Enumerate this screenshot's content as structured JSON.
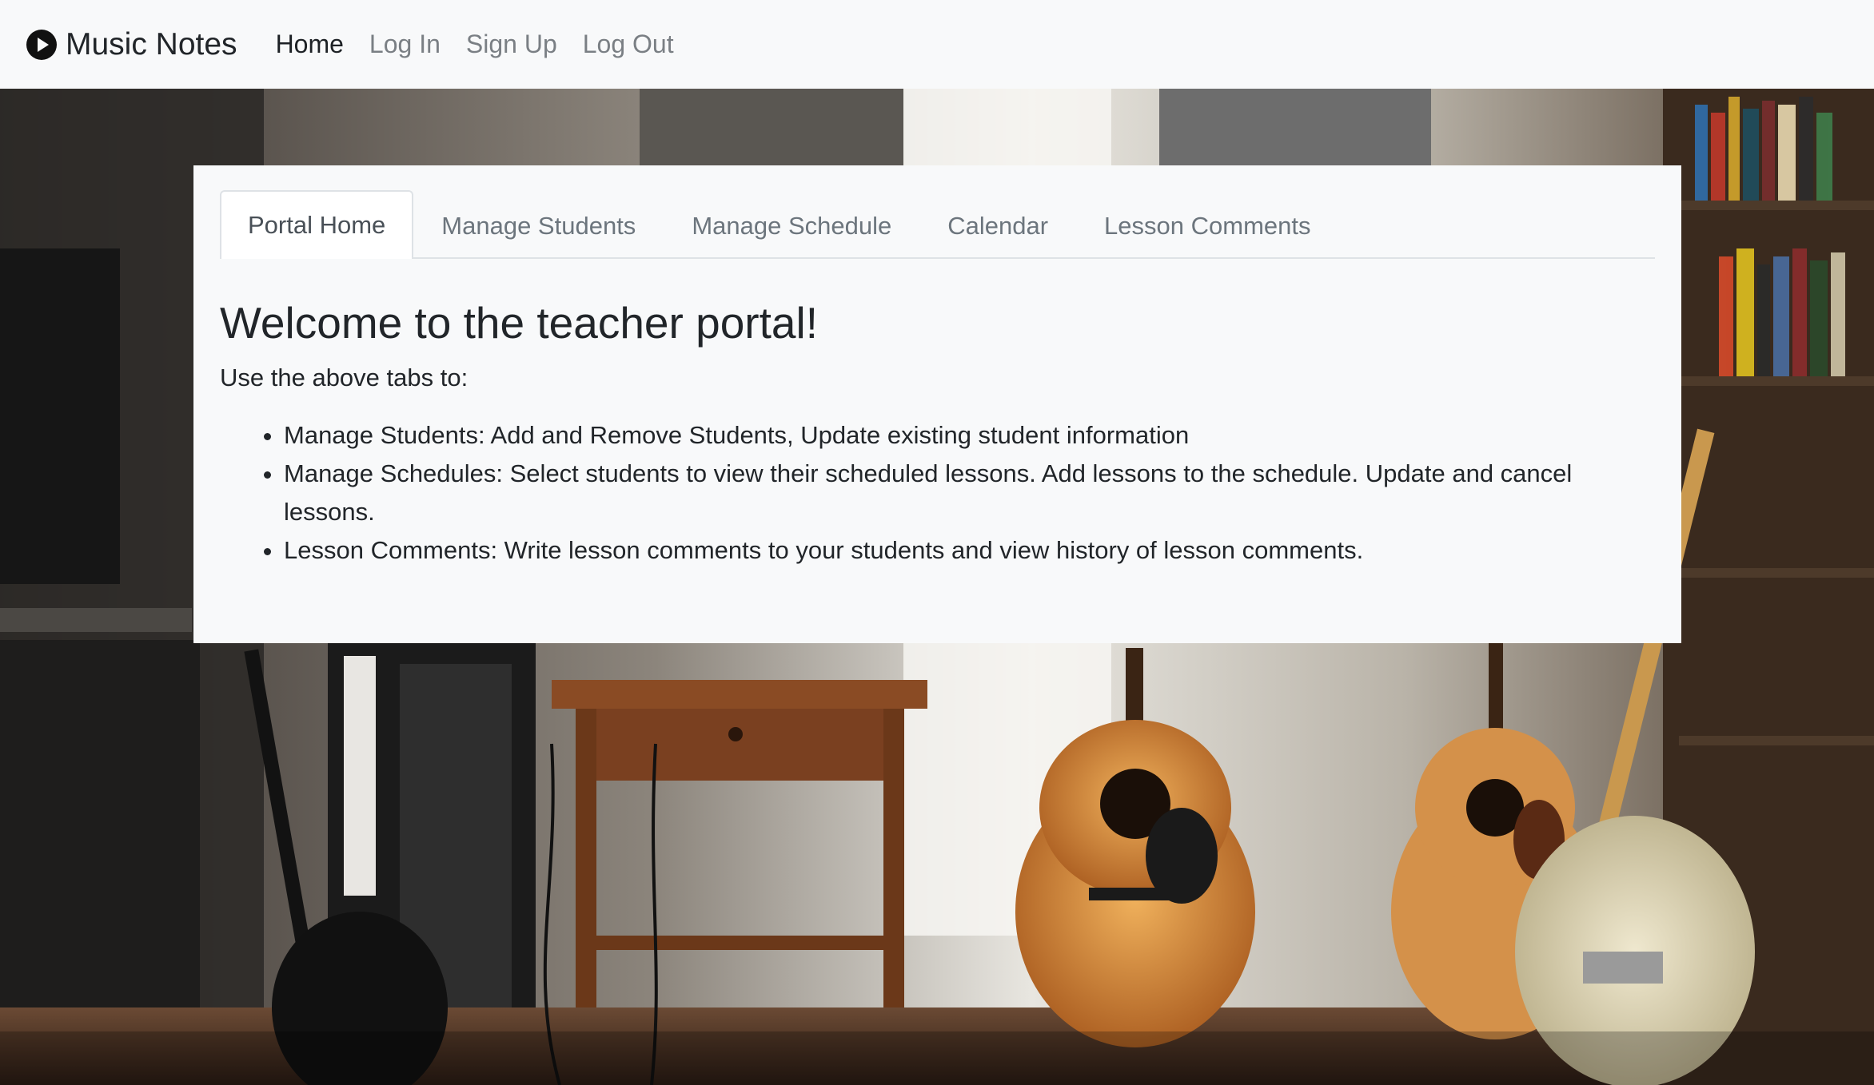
{
  "navbar": {
    "brand": "Music Notes",
    "links": [
      {
        "label": "Home",
        "active": true
      },
      {
        "label": "Log In",
        "active": false
      },
      {
        "label": "Sign Up",
        "active": false
      },
      {
        "label": "Log Out",
        "active": false
      }
    ]
  },
  "tabs": [
    {
      "label": "Portal Home",
      "active": true
    },
    {
      "label": "Manage Students",
      "active": false
    },
    {
      "label": "Manage Schedule",
      "active": false
    },
    {
      "label": "Calendar",
      "active": false
    },
    {
      "label": "Lesson Comments",
      "active": false
    }
  ],
  "content": {
    "heading": "Welcome to the teacher portal!",
    "intro": "Use the above tabs to:",
    "items": [
      "Manage Students: Add and Remove Students, Update existing student information",
      "Manage Schedules: Select students to view their scheduled lessons. Add lessons to the schedule. Update and cancel lessons.",
      "Lesson Comments: Write lesson comments to your students and view history of lesson comments."
    ]
  },
  "icons": {
    "brand_icon": "play-circle-icon"
  },
  "colors": {
    "navbar_bg": "#f8f9fa",
    "card_bg": "#f8f9fa",
    "active_tab_bg": "#ffffff",
    "link_muted": "#7a7f84"
  }
}
